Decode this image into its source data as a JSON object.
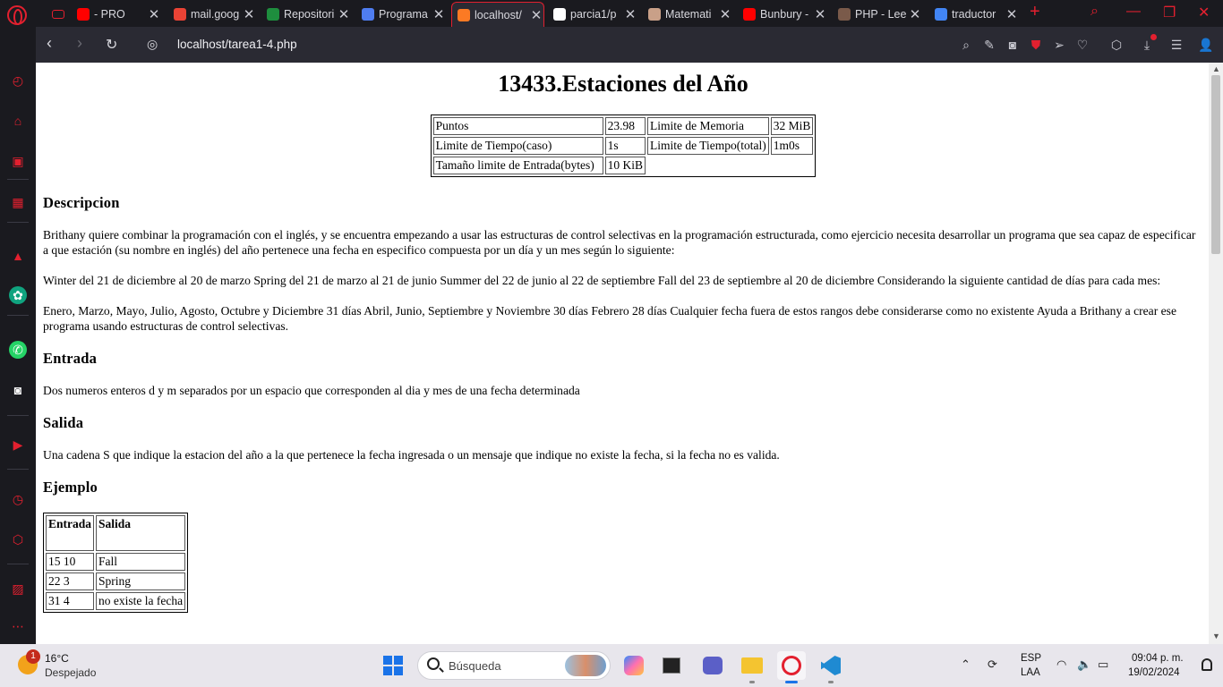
{
  "browser": {
    "tabs": [
      {
        "title": "- PRO",
        "favicon": "youtube-icon",
        "color": "#ff0000"
      },
      {
        "title": "mail.goog",
        "favicon": "gmail-icon",
        "color": "#ea4335"
      },
      {
        "title": "Repositori",
        "favicon": "classroom-icon",
        "color": "#1e8e3e"
      },
      {
        "title": "Programa",
        "favicon": "omega-icon",
        "color": "#4f7df0"
      },
      {
        "title": "localhost/",
        "favicon": "xampp-icon",
        "color": "#fb7a24",
        "active": true
      },
      {
        "title": "parcia1/p",
        "favicon": "github-icon",
        "color": "#ffffff"
      },
      {
        "title": "Matemati",
        "favicon": "elephant-icon",
        "color": "#c9a088"
      },
      {
        "title": "Bunbury -",
        "favicon": "youtube-icon",
        "color": "#ff0000"
      },
      {
        "title": "PHP - Lee",
        "favicon": "avatar-icon",
        "color": "#7a5a4a"
      },
      {
        "title": "traductor",
        "favicon": "google-icon",
        "color": "#4285f4"
      }
    ],
    "url": "localhost/tarea1-4.php"
  },
  "page": {
    "title": "13433.Estaciones del Año",
    "meta": {
      "puntos_label": "Puntos",
      "puntos_value": "23.98",
      "memoria_label": "Limite de Memoria",
      "memoria_value": "32 MiB",
      "tiempo_caso_label": "Limite de Tiempo(caso)",
      "tiempo_caso_value": "1s",
      "tiempo_total_label": "Limite de Tiempo(total)",
      "tiempo_total_value": "1m0s",
      "entrada_label": "Tamaño limite de Entrada(bytes)",
      "entrada_value": "10 KiB"
    },
    "descripcion_heading": "Descripcion",
    "descripcion_p1": "Brithany quiere combinar la programación con el inglés, y se encuentra empezando a usar las estructuras de control selectivas en la programación estructurada, como ejercicio necesita desarrollar un programa que sea capaz de especificar a que estación (su nombre en inglés) del año pertenece una fecha en especifico compuesta por un día y un mes según lo siguiente:",
    "descripcion_p2": "Winter del 21 de diciembre al 20 de marzo Spring del 21 de marzo al 21 de junio Summer del 22 de junio al 22 de septiembre Fall del 23 de septiembre al 20 de diciembre Considerando la siguiente cantidad de días para cada mes:",
    "descripcion_p3": "Enero, Marzo, Mayo, Julio, Agosto, Octubre y Diciembre 31 días Abril, Junio, Septiembre y Noviembre 30 días Febrero 28 días Cualquier fecha fuera de estos rangos debe considerarse como no existente Ayuda a Brithany a crear ese programa usando estructuras de control selectivas.",
    "entrada_heading": "Entrada",
    "entrada_text": "Dos numeros enteros d y m separados por un espacio que corresponden al dia y mes de una fecha determinada",
    "salida_heading": "Salida",
    "salida_text": "Una cadena S que indique la estacion del año a la que pertenece la fecha ingresada o un mensaje que indique no existe la fecha, si la fecha no es valida.",
    "ejemplo_heading": "Ejemplo",
    "ejemplo_headers": [
      "Entrada",
      "Salida"
    ],
    "ejemplo_rows": [
      [
        "15 10",
        "Fall"
      ],
      [
        "22 3",
        "Spring"
      ],
      [
        "31 4",
        "no existe la fecha"
      ]
    ]
  },
  "taskbar": {
    "weather_badge": "1",
    "temperature": "16°C",
    "weather": "Despejado",
    "search_label": "Búsqueda",
    "lang_top": "ESP",
    "lang_bottom": "LAA",
    "time": "09:04 p. m.",
    "date": "19/02/2024"
  }
}
